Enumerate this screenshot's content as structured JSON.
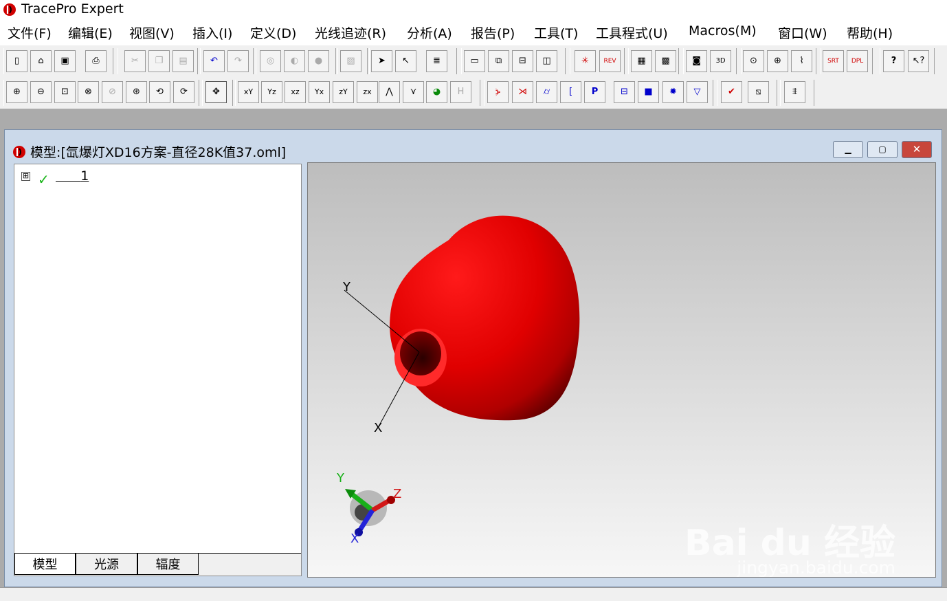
{
  "app": {
    "title": "TracePro Expert"
  },
  "menu": [
    "文件(F)",
    "编辑(E)",
    "视图(V)",
    "插入(I)",
    "定义(D)",
    "光线追迹(R)",
    "分析(A)",
    "报告(P)",
    "工具(T)",
    "工具程式(U)",
    "Macros(M)",
    "窗口(W)",
    "帮助(H)"
  ],
  "toolbar1": [
    "new",
    "open",
    "save",
    "print",
    "cut",
    "copy",
    "paste",
    "undo",
    "redo",
    "boolean-union",
    "boolean-subtract",
    "boolean-intersect",
    "sweep",
    "select",
    "select-surface",
    "notes",
    "window-single",
    "window-cascade",
    "window-tile-h",
    "window-tile-v",
    "trace-rays",
    "trace-rev",
    "grid-map",
    "color-map",
    "irradiance",
    "3d-map",
    "source",
    "sphere",
    "chart",
    "srt",
    "dpl",
    "help",
    "context-help"
  ],
  "toolbar1_labels": {
    "trace_rev": "REV",
    "three_d": "3D",
    "srt": "SRT",
    "dpl": "DPL",
    "help": "?"
  },
  "toolbar2": [
    "zoom-in",
    "zoom-out",
    "zoom-window",
    "zoom-all",
    "zoom-selection",
    "zoom-previous",
    "rotate-x",
    "rotate-y",
    "pan",
    "view-xy",
    "view-yz",
    "view-xz",
    "view-yx",
    "view-zy",
    "view-zx",
    "view-iso",
    "view-iso2",
    "view-custom",
    "render",
    "edges",
    "lens",
    "aperture",
    "mirror",
    "bracket",
    "prism",
    "thin-sheet",
    "block",
    "dot",
    "cone",
    "check",
    "ruler",
    "surface-normal"
  ],
  "toolbar2_labels": {
    "view_xy": "xY",
    "view_yz": "Yz",
    "view_xz": "xz",
    "view_yx": "Yx",
    "view_zy": "zY",
    "view_zx": "zx",
    "prism": "P"
  },
  "document": {
    "title": "模型:[氙爆灯XD16方案-直径28K值37.oml]",
    "win_buttons": {
      "minimize": "▁",
      "restore": "▢",
      "close": "✕"
    }
  },
  "tree": {
    "expander": "⊞",
    "items": [
      {
        "label": "1",
        "checked": true
      }
    ],
    "tabs": [
      "模型",
      "光源",
      "辐度"
    ]
  },
  "viewport": {
    "axes": {
      "y": "Y",
      "x": "X"
    },
    "triad": {
      "y": "Y",
      "z": "Z",
      "x": "X"
    },
    "model_color": "#e20000"
  },
  "watermark": {
    "line1": "Bai du 经验",
    "line2": "jingyan.baidu.com"
  }
}
